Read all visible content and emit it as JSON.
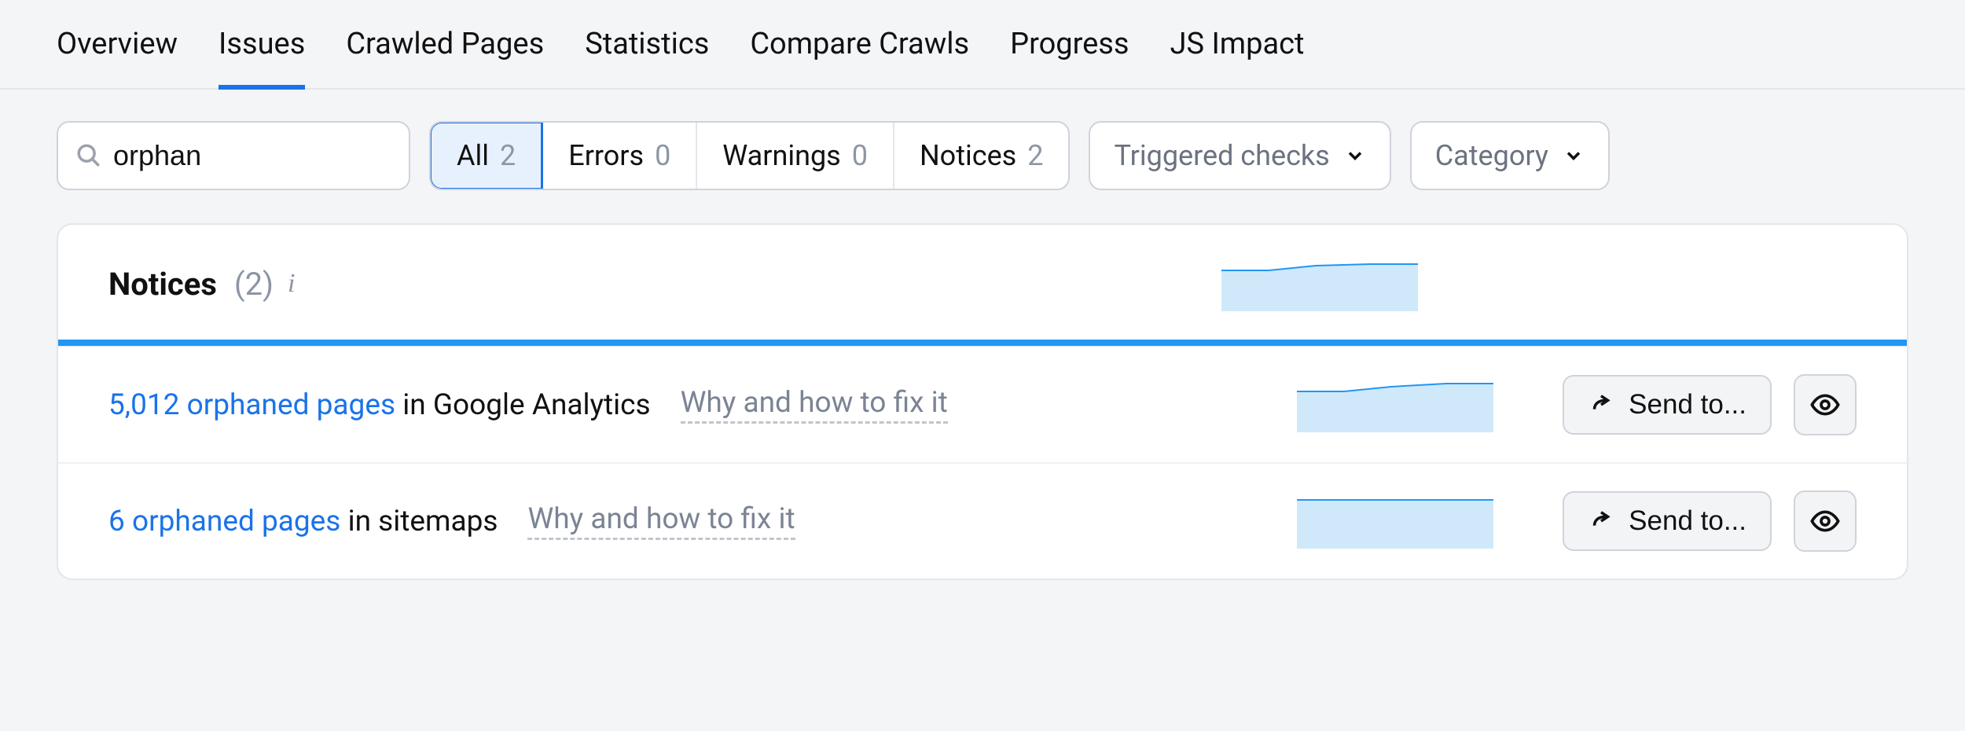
{
  "tabs": [
    {
      "label": "Overview"
    },
    {
      "label": "Issues"
    },
    {
      "label": "Crawled Pages"
    },
    {
      "label": "Statistics"
    },
    {
      "label": "Compare Crawls"
    },
    {
      "label": "Progress"
    },
    {
      "label": "JS Impact"
    }
  ],
  "active_tab": "Issues",
  "search": {
    "value": "orphan",
    "placeholder": ""
  },
  "filters": {
    "segments": [
      {
        "label": "All",
        "count": "2",
        "active": true
      },
      {
        "label": "Errors",
        "count": "0",
        "active": false
      },
      {
        "label": "Warnings",
        "count": "0",
        "active": false
      },
      {
        "label": "Notices",
        "count": "2",
        "active": false
      }
    ],
    "triggered_label": "Triggered checks",
    "category_label": "Category"
  },
  "panel": {
    "title": "Notices",
    "count": "(2)",
    "rows": [
      {
        "link_text": "5,012 orphaned pages",
        "rest_text": " in Google Analytics",
        "fix_label": "Why and how to fix it",
        "send_label": "Send to..."
      },
      {
        "link_text": "6 orphaned pages",
        "rest_text": " in sitemaps",
        "fix_label": "Why and how to fix it",
        "send_label": "Send to..."
      }
    ]
  }
}
